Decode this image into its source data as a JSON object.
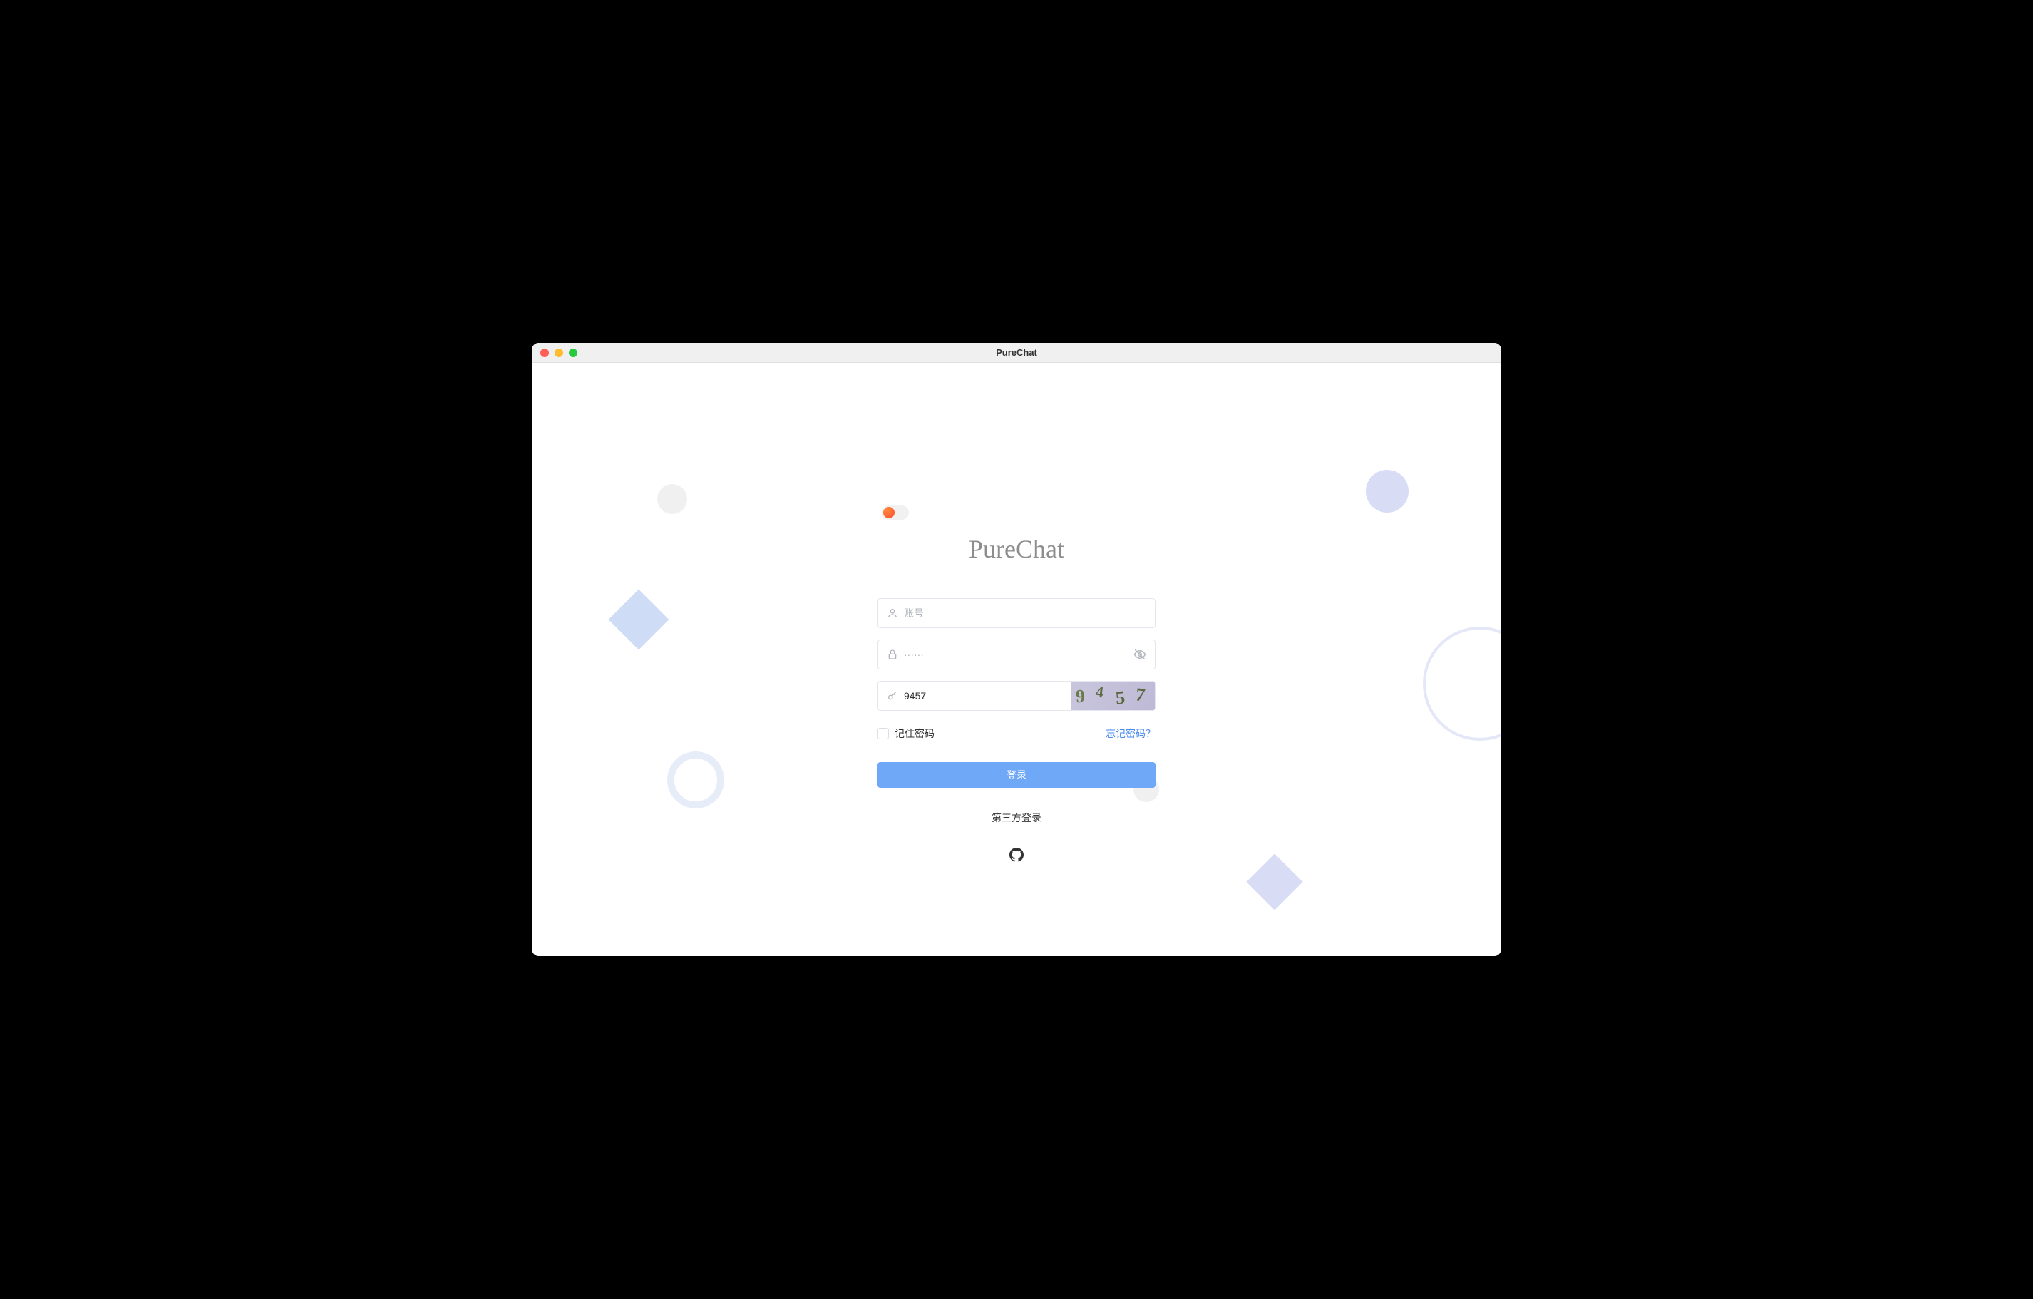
{
  "window": {
    "title": "PureChat"
  },
  "app": {
    "title": "PureChat"
  },
  "form": {
    "username": {
      "placeholder": "账号",
      "value": ""
    },
    "password": {
      "placeholder": "······",
      "value": ""
    },
    "captcha": {
      "placeholder": "",
      "value": "9457",
      "image_text": "9457"
    },
    "remember": {
      "label": "记住密码"
    },
    "forgot": {
      "label": "忘记密码？"
    },
    "submit": {
      "label": "登录"
    },
    "third_party": {
      "label": "第三方登录"
    }
  }
}
